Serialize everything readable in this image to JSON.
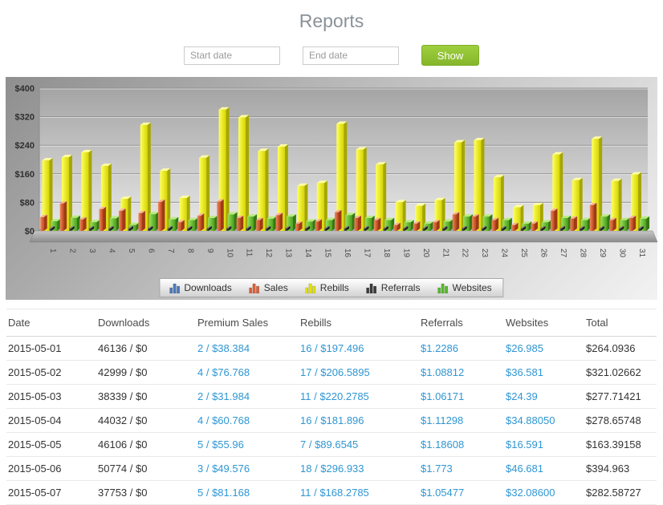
{
  "page": {
    "title": "Reports"
  },
  "filters": {
    "start_date_placeholder": "Start date",
    "end_date_placeholder": "End date",
    "show_button_label": "Show",
    "show_button_color": "#8fbf2f"
  },
  "chart_data": {
    "type": "bar",
    "title": "",
    "xlabel": "",
    "ylabel": "",
    "ylim": [
      0,
      400
    ],
    "y_ticks": [
      "$0",
      "$80",
      "$160",
      "$240",
      "$320",
      "$400"
    ],
    "grid": true,
    "legend_position": "bottom",
    "x_labels": [
      "1",
      "2",
      "3",
      "4",
      "5",
      "6",
      "7",
      "8",
      "9",
      "10",
      "11",
      "12",
      "13",
      "14",
      "15",
      "16",
      "17",
      "18",
      "19",
      "20",
      "21",
      "22",
      "23",
      "24",
      "25",
      "26",
      "27",
      "28",
      "29",
      "30",
      "31"
    ],
    "series": [
      {
        "name": "Downloads",
        "color": "#4a79b8",
        "values": [
          0,
          0,
          0,
          0,
          0,
          0,
          0,
          0,
          0,
          0,
          0,
          0,
          0,
          0,
          0,
          0,
          0,
          0,
          0,
          0,
          0,
          0,
          0,
          0,
          0,
          0,
          0,
          0,
          0,
          0,
          0
        ]
      },
      {
        "name": "Sales",
        "color": "#d9603b",
        "values": [
          38.384,
          76.768,
          31.984,
          60.768,
          55.96,
          49.576,
          81.168,
          24,
          42,
          82,
          36,
          30,
          44,
          20,
          26,
          52,
          36,
          30,
          16,
          20,
          24,
          46,
          40,
          30,
          16,
          20,
          56,
          34,
          72,
          30,
          36
        ]
      },
      {
        "name": "Rebills",
        "color": "#e2e200",
        "values": [
          197.496,
          206.5895,
          220.2785,
          181.896,
          89.6545,
          296.933,
          168.2785,
          92,
          205,
          340,
          318,
          224,
          236,
          126,
          134,
          300,
          228,
          186,
          80,
          70,
          86,
          248,
          254,
          150,
          66,
          72,
          214,
          142,
          258,
          140,
          158
        ]
      },
      {
        "name": "Referrals",
        "color": "#3a3a3a",
        "values": [
          1.2286,
          1.08812,
          1.06171,
          1.11298,
          1.18608,
          1.773,
          1.05477,
          1,
          1,
          1,
          1,
          1,
          1,
          1,
          1,
          1,
          1,
          1,
          1,
          1,
          1,
          1,
          1,
          1,
          1,
          1,
          1,
          1,
          1,
          1,
          1
        ]
      },
      {
        "name": "Websites",
        "color": "#55b82a",
        "values": [
          26.985,
          36.581,
          24.39,
          34.8805,
          16.591,
          46.681,
          32.086,
          30,
          36,
          46,
          40,
          34,
          40,
          26,
          30,
          44,
          36,
          30,
          24,
          20,
          26,
          40,
          40,
          30,
          20,
          24,
          36,
          30,
          40,
          30,
          34
        ]
      }
    ]
  },
  "table": {
    "columns": [
      "Date",
      "Downloads",
      "Premium Sales",
      "Rebills",
      "Referrals",
      "Websites",
      "Total"
    ],
    "rows": [
      [
        "2015-05-01",
        "46136 / $0",
        "2 / $38.384",
        "16 / $197.496",
        "$1.2286",
        "$26.985",
        "$264.0936"
      ],
      [
        "2015-05-02",
        "42999 / $0",
        "4 / $76.768",
        "17 / $206.5895",
        "$1.08812",
        "$36.581",
        "$321.02662"
      ],
      [
        "2015-05-03",
        "38339 / $0",
        "2 / $31.984",
        "11 / $220.2785",
        "$1.06171",
        "$24.39",
        "$277.71421"
      ],
      [
        "2015-05-04",
        "44032 / $0",
        "4 / $60.768",
        "16 / $181.896",
        "$1.11298",
        "$34.88050",
        "$278.65748"
      ],
      [
        "2015-05-05",
        "46106 / $0",
        "5 / $55.96",
        "7 / $89.6545",
        "$1.18608",
        "$16.591",
        "$163.39158"
      ],
      [
        "2015-05-06",
        "50774 / $0",
        "3 / $49.576",
        "18 / $296.933",
        "$1.773",
        "$46.681",
        "$394.963"
      ],
      [
        "2015-05-07",
        "37753 / $0",
        "5 / $81.168",
        "11 / $168.2785",
        "$1.05477",
        "$32.08600",
        "$282.58727"
      ]
    ]
  }
}
